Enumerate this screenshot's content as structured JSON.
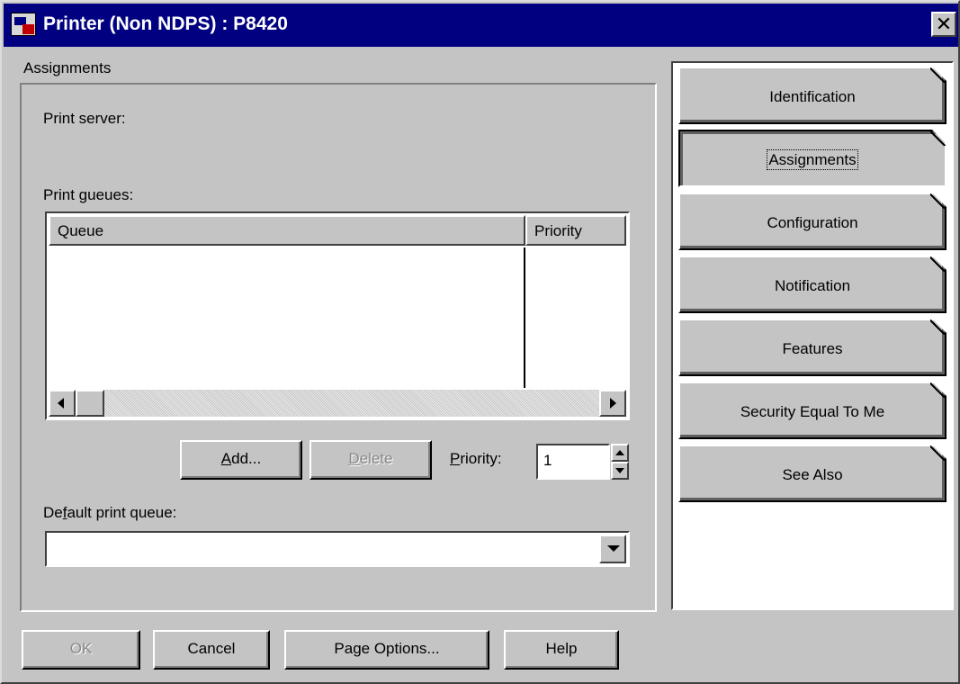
{
  "window": {
    "title": "Printer (Non NDPS) : P8420",
    "close_glyph": "✕"
  },
  "assignments": {
    "group_label": "Assignments",
    "print_server_label": "Print server:",
    "print_queues_label": "Print gueues:",
    "columns": [
      "Queue",
      "Priority"
    ],
    "rows": [],
    "add_button": {
      "pre": "",
      "accel": "A",
      "post": "dd..."
    },
    "delete_button": {
      "pre": "",
      "accel": "D",
      "post": "elete"
    },
    "priority_label": {
      "pre": "",
      "accel": "P",
      "post": "riority:"
    },
    "priority_value": "1",
    "default_queue_label": {
      "pre": "De",
      "accel": "f",
      "post": "ault print queue:"
    },
    "default_queue_value": ""
  },
  "tabs": [
    {
      "label": "Identification",
      "active": false
    },
    {
      "label": "Assignments",
      "active": true
    },
    {
      "label": "Configuration",
      "active": false
    },
    {
      "label": "Notification",
      "active": false
    },
    {
      "label": "Features",
      "active": false
    },
    {
      "label": "Security Equal To Me",
      "active": false
    },
    {
      "label": "See Also",
      "active": false
    }
  ],
  "footer": {
    "ok": "OK",
    "cancel": "Cancel",
    "page_options": "Page Options...",
    "help": "Help"
  }
}
